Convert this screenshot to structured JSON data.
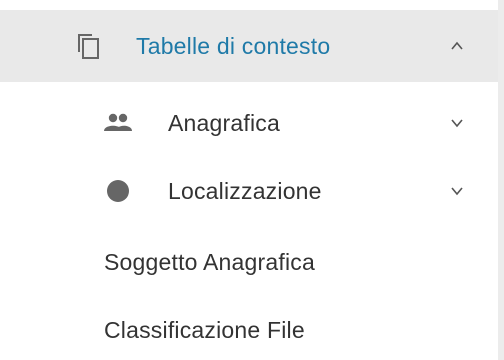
{
  "menu": {
    "header": {
      "label": "Tabelle di contesto",
      "icon": "copy-icon",
      "expanded": true
    },
    "items": [
      {
        "label": "Anagrafica",
        "icon": "people-icon",
        "expanded": false
      },
      {
        "label": "Localizzazione",
        "icon": "circle-icon",
        "expanded": false
      },
      {
        "label": "Soggetto Anagrafica"
      },
      {
        "label": "Classificazione File"
      }
    ]
  },
  "colors": {
    "accent": "#1f7aa8",
    "header_bg": "#e9e9e9",
    "text": "#333333",
    "icon": "#666666"
  }
}
